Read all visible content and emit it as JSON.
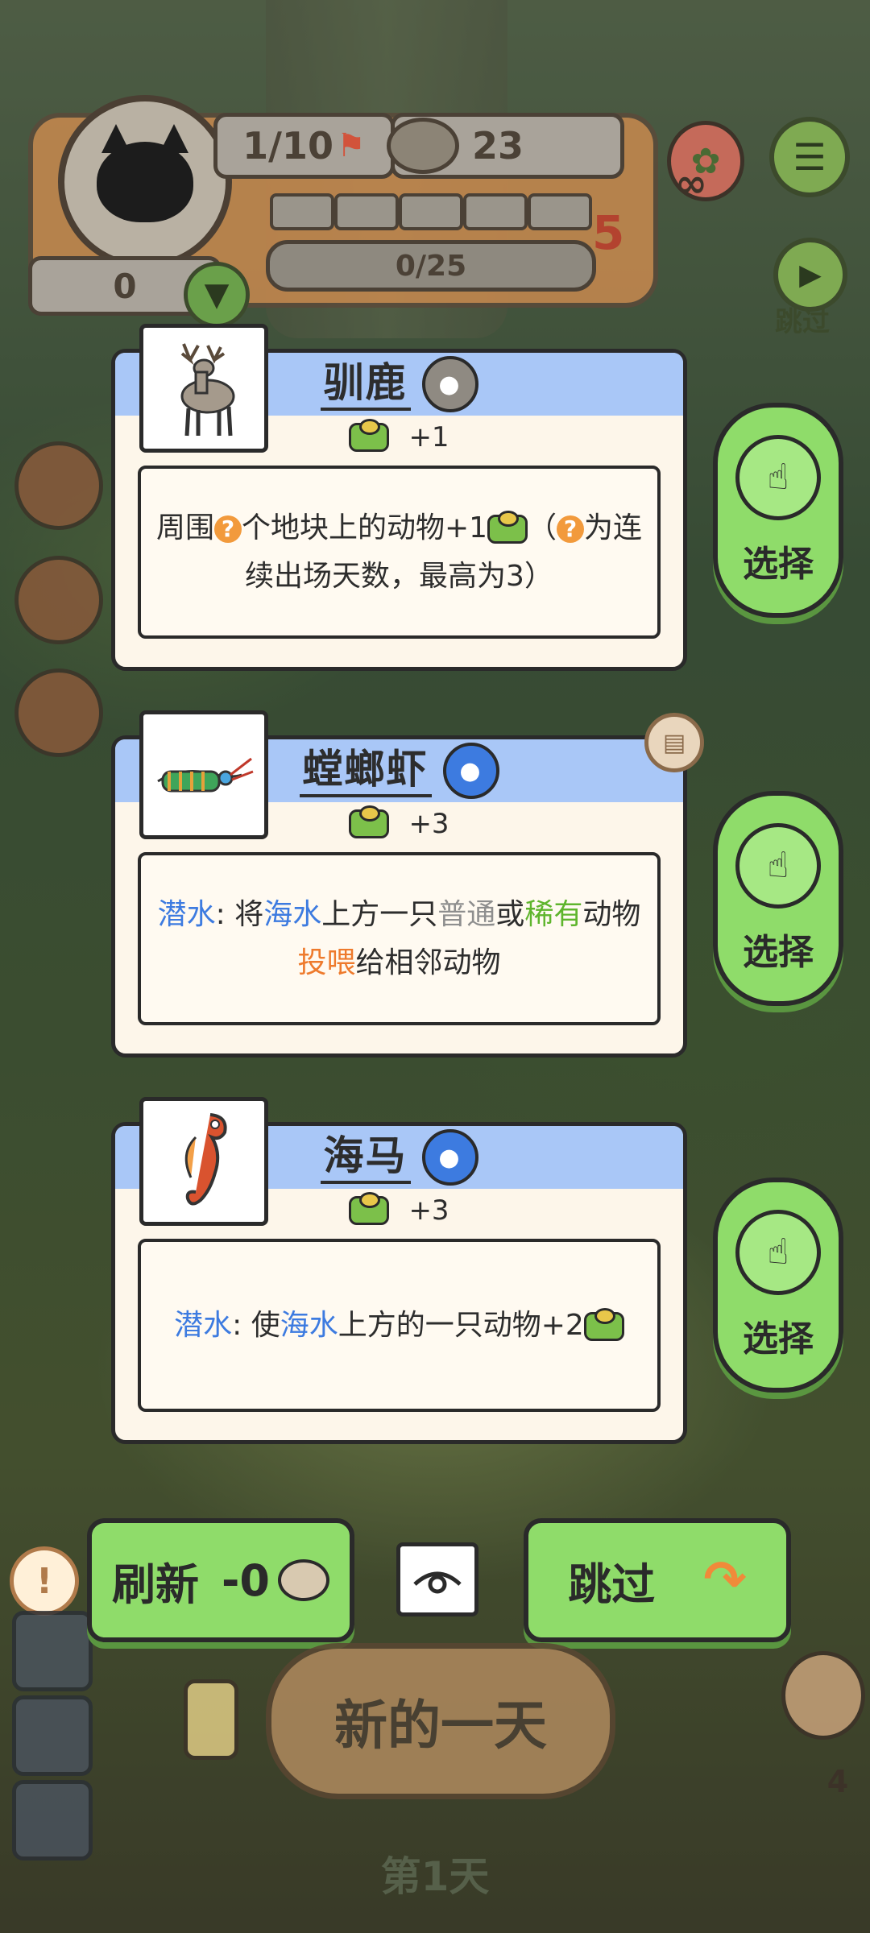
{
  "hud": {
    "level": "1/10",
    "cans": "23",
    "progress": "0/25",
    "progress_fraction": 0,
    "counter": "0",
    "star_number": "5",
    "skip_label": "跳过",
    "infinity": "∞"
  },
  "cards": [
    {
      "name": "驯鹿",
      "type_icon": "land-type-icon",
      "food": "+1",
      "desc_parts": [
        {
          "text": "周围",
          "cls": ""
        },
        {
          "text": "?",
          "cls": "q"
        },
        {
          "text": "个地块上的动物+1",
          "cls": ""
        },
        {
          "text": "food",
          "cls": "food"
        },
        {
          "text": "（",
          "cls": ""
        },
        {
          "text": "?",
          "cls": "q"
        },
        {
          "text": "为连续出场天数，最高为3）",
          "cls": ""
        }
      ]
    },
    {
      "name": "螳螂虾",
      "type_icon": "sea-type-icon",
      "food": "+3",
      "desc_parts": [
        {
          "text": "潜水",
          "cls": "blue"
        },
        {
          "text": ": 将",
          "cls": ""
        },
        {
          "text": "海水",
          "cls": "blue"
        },
        {
          "text": "上方一只",
          "cls": ""
        },
        {
          "text": "普通",
          "cls": "gray"
        },
        {
          "text": "或",
          "cls": ""
        },
        {
          "text": "稀有",
          "cls": "green"
        },
        {
          "text": "动物",
          "cls": ""
        },
        {
          "text": "投喂",
          "cls": "orange"
        },
        {
          "text": "给相邻动物",
          "cls": ""
        }
      ]
    },
    {
      "name": "海马",
      "type_icon": "sea-type-icon",
      "food": "+3",
      "desc_parts": [
        {
          "text": "潜水",
          "cls": "blue"
        },
        {
          "text": ": 使",
          "cls": ""
        },
        {
          "text": "海水",
          "cls": "blue"
        },
        {
          "text": "上方的一只动物+2",
          "cls": ""
        },
        {
          "text": "food",
          "cls": "food"
        }
      ]
    }
  ],
  "select_label": "选择",
  "refresh": {
    "label": "刷新",
    "cost": "-0"
  },
  "skip": {
    "label": "跳过"
  },
  "new_day": "新的一天",
  "day": "第1天",
  "corner_count": "4",
  "colors": {
    "card_title_band": "#a9c7f7",
    "select_green": "#8fdc6a",
    "sea_blue": "#3d7be0"
  }
}
